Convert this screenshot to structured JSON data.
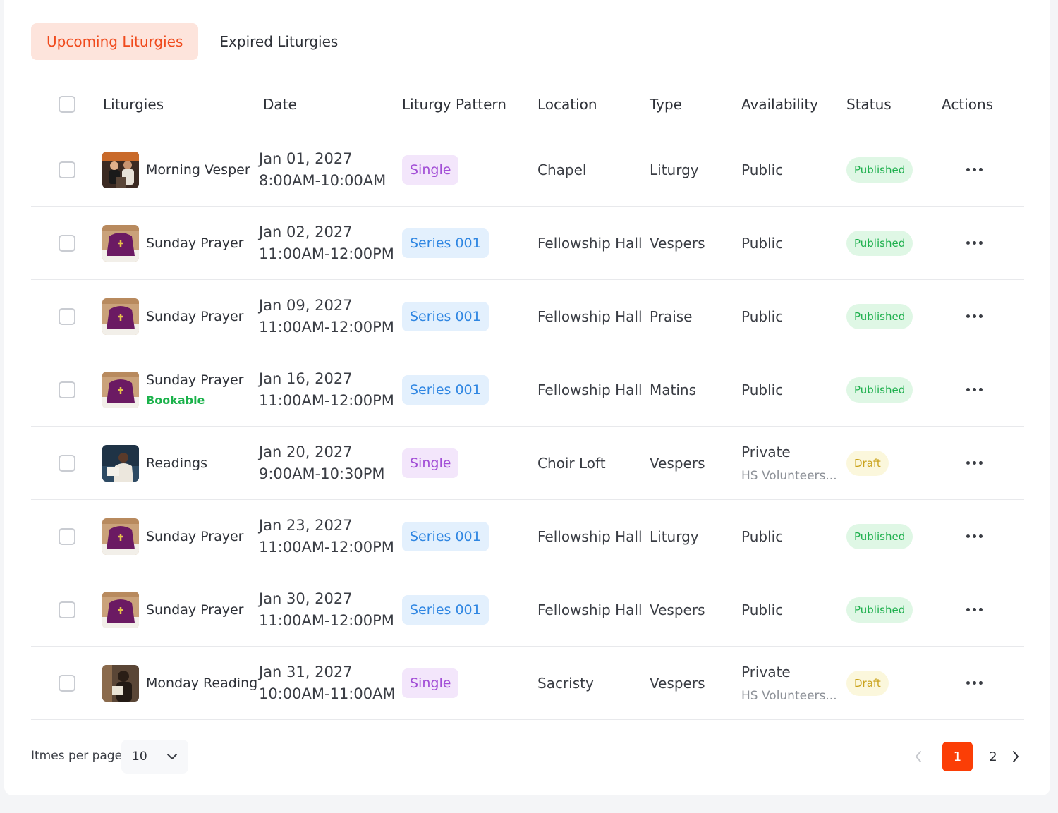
{
  "tabs": [
    {
      "label": "Upcoming Liturgies",
      "active": true
    },
    {
      "label": "Expired Liturgies",
      "active": false
    }
  ],
  "columns": {
    "liturgies": "Liturgies",
    "date": "Date",
    "pattern": "Liturgy Pattern",
    "location": "Location",
    "type": "Type",
    "availability": "Availability",
    "status": "Status",
    "actions": "Actions"
  },
  "rows": [
    {
      "thumb": "people-photo",
      "name": "Morning Vesper",
      "tag": "",
      "date": "Jan 01, 2027",
      "time": "8:00AM-10:00AM",
      "pattern": "Single",
      "pattern_kind": "single",
      "location": "Chapel",
      "type": "Liturgy",
      "availability": "Public",
      "availability_sub": "",
      "status": "Published",
      "status_kind": "published"
    },
    {
      "thumb": "altar-photo",
      "name": "Sunday Prayer",
      "tag": "",
      "date": "Jan 02, 2027",
      "time": "11:00AM-12:00PM",
      "pattern": "Series 001",
      "pattern_kind": "series",
      "location": "Fellowship Hall",
      "type": "Vespers",
      "availability": "Public",
      "availability_sub": "",
      "status": "Published",
      "status_kind": "published"
    },
    {
      "thumb": "altar-photo",
      "name": "Sunday Prayer",
      "tag": "",
      "date": "Jan 09, 2027",
      "time": "11:00AM-12:00PM",
      "pattern": "Series 001",
      "pattern_kind": "series",
      "location": "Fellowship Hall",
      "type": "Praise",
      "availability": "Public",
      "availability_sub": "",
      "status": "Published",
      "status_kind": "published"
    },
    {
      "thumb": "altar-photo",
      "name": "Sunday Prayer",
      "tag": "Bookable",
      "date": "Jan 16, 2027",
      "time": "11:00AM-12:00PM",
      "pattern": "Series 001",
      "pattern_kind": "series",
      "location": "Fellowship Hall",
      "type": "Matins",
      "availability": "Public",
      "availability_sub": "",
      "status": "Published",
      "status_kind": "published"
    },
    {
      "thumb": "reader-photo",
      "name": "Readings",
      "tag": "",
      "date": "Jan 20, 2027",
      "time": "9:00AM-10:30PM",
      "pattern": "Single",
      "pattern_kind": "single",
      "location": "Choir Loft",
      "type": "Vespers",
      "availability": "Private",
      "availability_sub": "HS Volunteers...",
      "status": "Draft",
      "status_kind": "draft"
    },
    {
      "thumb": "altar-photo",
      "name": "Sunday Prayer",
      "tag": "",
      "date": "Jan 23, 2027",
      "time": "11:00AM-12:00PM",
      "pattern": "Series 001",
      "pattern_kind": "series",
      "location": "Fellowship Hall",
      "type": "Liturgy",
      "availability": "Public",
      "availability_sub": "",
      "status": "Published",
      "status_kind": "published"
    },
    {
      "thumb": "altar-photo",
      "name": "Sunday Prayer",
      "tag": "",
      "date": "Jan 30, 2027",
      "time": "11:00AM-12:00PM",
      "pattern": "Series 001",
      "pattern_kind": "series",
      "location": "Fellowship Hall",
      "type": "Vespers",
      "availability": "Public",
      "availability_sub": "",
      "status": "Published",
      "status_kind": "published"
    },
    {
      "thumb": "book-photo",
      "name": "Monday Reading",
      "tag": "",
      "date": "Jan 31, 2027",
      "time": "10:00AM-11:00AM",
      "pattern": "Single",
      "pattern_kind": "single",
      "location": "Sacristy",
      "type": "Vespers",
      "availability": "Private",
      "availability_sub": "HS Volunteers...",
      "status": "Draft",
      "status_kind": "draft"
    }
  ],
  "footer": {
    "items_per_page_label": "Itmes per page",
    "items_per_page_value": "10",
    "pages": [
      "1",
      "2"
    ],
    "current_page": "1"
  },
  "colors": {
    "accent": "#fb3e06",
    "published": "#1fb04e",
    "draft": "#c9a21a",
    "single": "#a24dd6",
    "series": "#2f86e2"
  }
}
